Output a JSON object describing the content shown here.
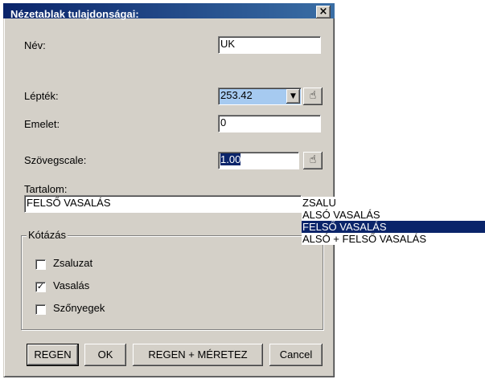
{
  "dialog": {
    "title": "Nézetablak tulajdonságai:",
    "close": "×"
  },
  "fields": {
    "nev_label": "Név:",
    "nev_value": "UK",
    "leptek_label": "Lépték:",
    "leptek_value": "253.42",
    "emelet_label": "Emelet:",
    "emelet_value": "0",
    "szovegscale_label": "Szövegscale:",
    "szovegscale_value": "1.00",
    "tartalom_label": "Tartalom:",
    "tartalom_value": "FELSŐ VASALÁS"
  },
  "icons": {
    "hand": "☝",
    "dropdown": "▼"
  },
  "kotazas": {
    "legend": "Kótázás",
    "items": [
      {
        "label": "Zsaluzat",
        "checked": false,
        "mark": ""
      },
      {
        "label": "Vasalás",
        "checked": true,
        "mark": "✓"
      },
      {
        "label": "Szőnyegek",
        "checked": false,
        "mark": ""
      }
    ]
  },
  "buttons": {
    "regen": "REGEN",
    "ok": "OK",
    "regen_meretez": "REGEN + MÉRETEZ",
    "cancel": "Cancel"
  },
  "dropdown": {
    "items": [
      "ZSALU",
      "ALSÓ VASALÁS",
      "FELSŐ VASALÁS",
      "ALSÓ + FELSŐ VASALÁS"
    ],
    "selected": "FELSŐ VASALÁS"
  },
  "colors": {
    "titlebar_start": "#0a246a",
    "titlebar_end": "#3a6ea5",
    "dialog_bg": "#d4d0c8",
    "highlight": "#0a246a",
    "selection_field": "#a6caf0"
  }
}
